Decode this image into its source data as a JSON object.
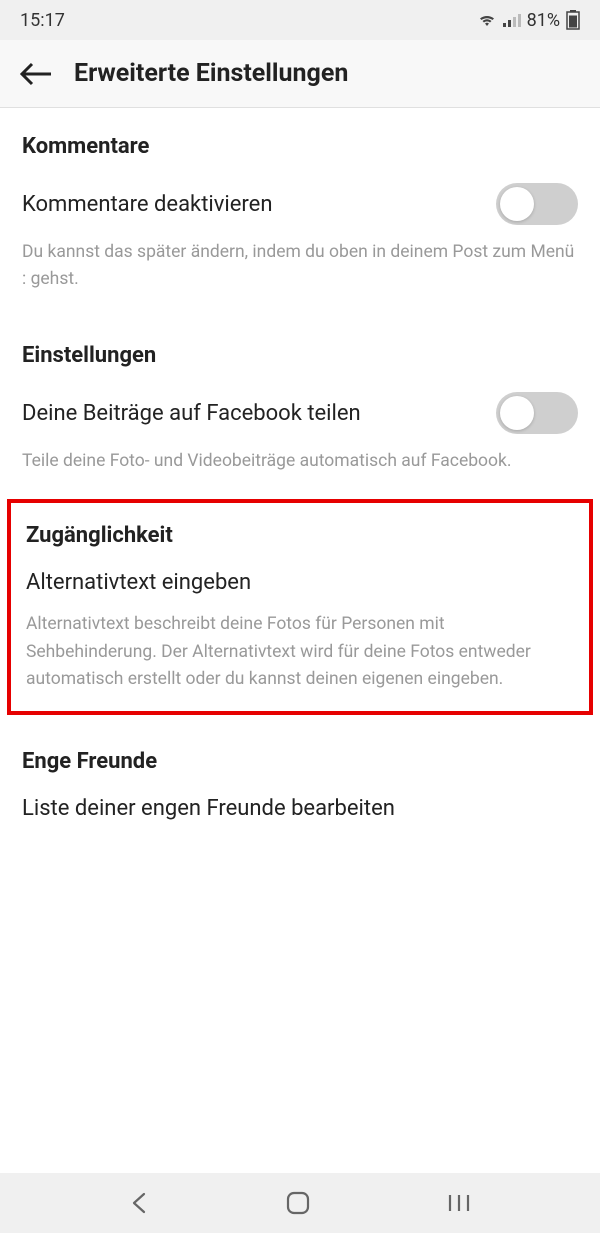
{
  "status": {
    "time": "15:17",
    "battery_pct": "81"
  },
  "header": {
    "title": "Erweiterte Einstellungen"
  },
  "sections": {
    "comments": {
      "title": "Kommentare",
      "toggle_label": "Kommentare deaktivieren",
      "desc": "Du kannst das später ändern, indem du oben in deinem Post zum Menü\n: gehst."
    },
    "settings": {
      "title": "Einstellungen",
      "toggle_label": "Deine Beiträge auf Facebook teilen",
      "desc": "Teile deine Foto- und Videobeiträge automatisch auf Facebook."
    },
    "accessibility": {
      "title": "Zugänglichkeit",
      "item_label": "Alternativtext eingeben",
      "desc": "Alternativtext beschreibt deine Fotos für Personen mit Sehbehinderung. Der Alternativtext wird für deine Fotos entweder automatisch erstellt oder du kannst deinen eigenen eingeben."
    },
    "close_friends": {
      "title": "Enge Freunde",
      "item_label": "Liste deiner engen Freunde bearbeiten"
    }
  }
}
